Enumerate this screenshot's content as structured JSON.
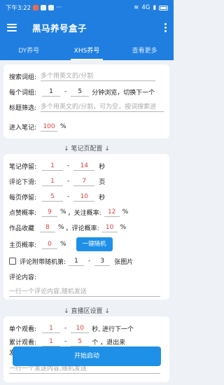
{
  "status": {
    "time": "下午3:22",
    "signal": "4G"
  },
  "app": {
    "title": "黑马养号盒子"
  },
  "tabs": [
    "DY养号",
    "XHS养号",
    "查看更多"
  ],
  "search": {
    "label": "搜索词组:",
    "placeholder": "多个用英文的/分割"
  },
  "per_word": {
    "label": "每个词组:",
    "min": "1",
    "max": "5",
    "suffix": "分钟浏览，切换下一个"
  },
  "title_filter": {
    "label": "标题筛选:",
    "placeholder": "多个用英文的/分割，可为空，按词搜索进"
  },
  "enter_note": {
    "label": "进入笔记:",
    "value": "100",
    "unit": "%"
  },
  "note_config_head": "↓ 笔记页配置 ↓",
  "note_stay": {
    "label": "笔记停留:",
    "min": "1",
    "max": "14",
    "unit": "秒"
  },
  "comment_scroll": {
    "label": "评论下滑:",
    "min": "1",
    "max": "7",
    "unit": "页"
  },
  "home_stay": {
    "label": "每页停留:",
    "min": "5",
    "max": "10",
    "unit": "秒"
  },
  "like_rate": {
    "label": "点赞概率:",
    "value": "9",
    "unit": "%",
    "follow_label": "关注概率:",
    "follow_value": "12",
    "follow_unit": "%"
  },
  "collect_rate": {
    "label": "作品收藏",
    "value": "8",
    "unit": "%",
    "comment_label": "评论概率:",
    "comment_value": "10",
    "comment_unit": "%"
  },
  "home_rate": {
    "label": "主页概率:",
    "value": "0",
    "unit": "%",
    "button": "一键随机"
  },
  "comment_img": {
    "label": "评论附带随机第:",
    "min": "1",
    "max": "3",
    "suffix": "张图片"
  },
  "comment_content": {
    "label": "评论内容:",
    "placeholder": "一行一个评论内容,随机发送"
  },
  "live_head": "↓ 直播区设置 ↓",
  "live_watch": {
    "label": "单个观看:",
    "min": "1",
    "max": "10",
    "suffix": "秒, 进行下一个"
  },
  "live_total": {
    "label": "累计观看:",
    "min": "1",
    "max": "5",
    "suffix": "个 ，退出来"
  },
  "live_send_label": "发",
  "live_send_placeholder": "一行一个发送内容,随机发送",
  "start_button": "开始启动"
}
